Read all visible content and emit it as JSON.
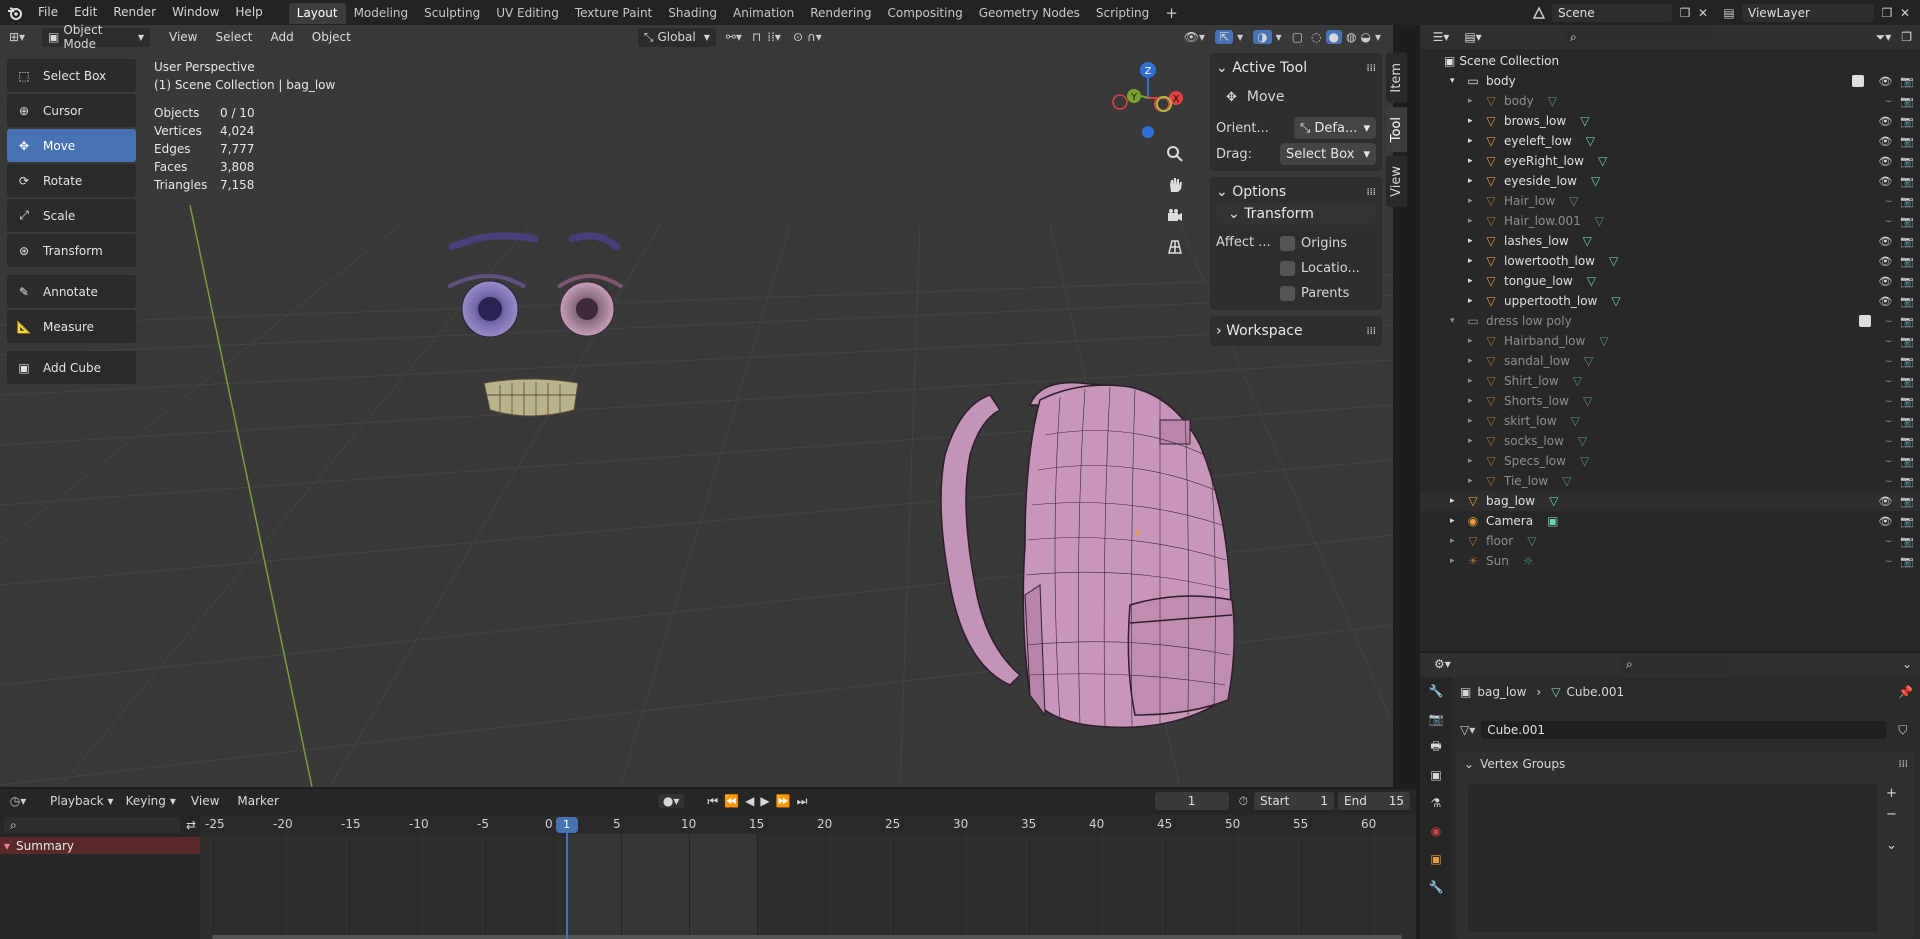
{
  "topbar": {
    "menus": [
      "File",
      "Edit",
      "Render",
      "Window",
      "Help"
    ],
    "workspaces": [
      "Layout",
      "Modeling",
      "Sculpting",
      "UV Editing",
      "Texture Paint",
      "Shading",
      "Animation",
      "Rendering",
      "Compositing",
      "Geometry Nodes",
      "Scripting"
    ],
    "active_workspace": "Layout",
    "add_tab": "+",
    "scene": "Scene",
    "view_layer": "ViewLayer"
  },
  "viewport_header": {
    "mode": "Object Mode",
    "menus": [
      "View",
      "Select",
      "Add",
      "Object"
    ],
    "orientation": "Global"
  },
  "toolbar": {
    "tools": [
      {
        "label": "Select Box",
        "icon": "select-box-icon"
      },
      {
        "label": "Cursor",
        "icon": "cursor-icon"
      },
      {
        "label": "Move",
        "icon": "move-icon",
        "active": true
      },
      {
        "label": "Rotate",
        "icon": "rotate-icon"
      },
      {
        "label": "Scale",
        "icon": "scale-icon"
      },
      {
        "label": "Transform",
        "icon": "transform-icon"
      },
      {
        "label": "Annotate",
        "icon": "annotate-icon"
      },
      {
        "label": "Measure",
        "icon": "measure-icon"
      },
      {
        "label": "Add Cube",
        "icon": "add-cube-icon"
      }
    ]
  },
  "viewport_info": {
    "perspective": "User Perspective",
    "collection": "(1) Scene Collection | bag_low",
    "stats": [
      {
        "label": "Objects",
        "value": "0 / 10"
      },
      {
        "label": "Vertices",
        "value": "4,024"
      },
      {
        "label": "Edges",
        "value": "7,777"
      },
      {
        "label": "Faces",
        "value": "3,808"
      },
      {
        "label": "Triangles",
        "value": "7,158"
      }
    ]
  },
  "gizmo": {
    "x": "X",
    "y": "Y",
    "z": "Z"
  },
  "npanel": {
    "active_tool_title": "Active Tool",
    "tool_name": "Move",
    "orient_label": "Orient...",
    "orient_value": "Defa...",
    "drag_label": "Drag:",
    "drag_value": "Select Box",
    "options_title": "Options",
    "transform_title": "Transform",
    "affect_label": "Affect ...",
    "affect_options": [
      "Origins",
      "Locatio...",
      "Parents"
    ],
    "workspace_title": "Workspace",
    "tabs": [
      "Item",
      "Tool",
      "View"
    ],
    "active_tab": "Tool"
  },
  "timeline": {
    "menus": [
      "Playback",
      "Keying",
      "View",
      "Marker"
    ],
    "current_frame": "1",
    "start_label": "Start",
    "start": "1",
    "end_label": "End",
    "end": "15",
    "ticks": [
      "-25",
      "-20",
      "-15",
      "-10",
      "-5",
      "0",
      "5",
      "10",
      "15",
      "20",
      "25",
      "30",
      "35",
      "40",
      "45",
      "50",
      "55",
      "60"
    ],
    "summary": "Summary",
    "playhead": "1"
  },
  "outliner": {
    "root": "Scene Collection",
    "rows": [
      {
        "name": "body",
        "level": 1,
        "type": "collection",
        "dim": false
      },
      {
        "name": "body",
        "level": 2,
        "type": "mesh",
        "dim": true
      },
      {
        "name": "brows_low",
        "level": 2,
        "type": "mesh",
        "dim": false
      },
      {
        "name": "eyeleft_low",
        "level": 2,
        "type": "mesh",
        "dim": false
      },
      {
        "name": "eyeRight_low",
        "level": 2,
        "type": "mesh",
        "dim": false
      },
      {
        "name": "eyeside_low",
        "level": 2,
        "type": "mesh",
        "dim": false
      },
      {
        "name": "Hair_low",
        "level": 2,
        "type": "mesh",
        "dim": true
      },
      {
        "name": "Hair_low.001",
        "level": 2,
        "type": "mesh",
        "dim": true
      },
      {
        "name": "lashes_low",
        "level": 2,
        "type": "mesh",
        "dim": false
      },
      {
        "name": "lowertooth_low",
        "level": 2,
        "type": "mesh",
        "dim": false
      },
      {
        "name": "tongue_low",
        "level": 2,
        "type": "mesh",
        "dim": false
      },
      {
        "name": "uppertooth_low",
        "level": 2,
        "type": "mesh",
        "dim": false
      },
      {
        "name": "dress low poly",
        "level": 1,
        "type": "collection",
        "dim": true
      },
      {
        "name": "Hairband_low",
        "level": 2,
        "type": "mesh",
        "dim": true
      },
      {
        "name": "sandal_low",
        "level": 2,
        "type": "mesh",
        "dim": true
      },
      {
        "name": "Shirt_low",
        "level": 2,
        "type": "mesh",
        "dim": true
      },
      {
        "name": "Shorts_low",
        "level": 2,
        "type": "mesh",
        "dim": true
      },
      {
        "name": "skirt_low",
        "level": 2,
        "type": "mesh",
        "dim": true
      },
      {
        "name": "socks_low",
        "level": 2,
        "type": "mesh",
        "dim": true
      },
      {
        "name": "Specs_low",
        "level": 2,
        "type": "mesh",
        "dim": true
      },
      {
        "name": "Tie_low",
        "level": 2,
        "type": "mesh",
        "dim": true
      },
      {
        "name": "bag_low",
        "level": 1,
        "type": "mesh",
        "dim": false
      },
      {
        "name": "Camera",
        "level": 1,
        "type": "camera",
        "dim": false
      },
      {
        "name": "floor",
        "level": 1,
        "type": "mesh",
        "dim": true
      },
      {
        "name": "Sun",
        "level": 1,
        "type": "light",
        "dim": true
      }
    ]
  },
  "properties": {
    "object": "bag_low",
    "mesh": "Cube.001",
    "mesh_field": "Cube.001",
    "vertex_groups": "Vertex Groups"
  },
  "colors": {
    "accent": "#4772b3",
    "mesh_icon": "#e89a3c",
    "data_icon": "#6fd0b0"
  }
}
